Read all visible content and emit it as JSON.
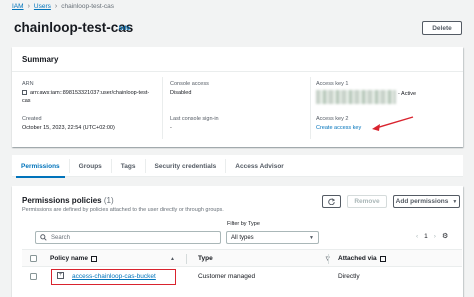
{
  "breadcrumb": {
    "root": "IAM",
    "users": "Users",
    "current": "chainloop-test-cas"
  },
  "header": {
    "title": "chainloop-test-cas",
    "info": "Info",
    "delete_label": "Delete"
  },
  "summary": {
    "title": "Summary",
    "arn_label": "ARN",
    "arn_value": "arn:aws:iam::898153321037:user/chainloop-test-cas",
    "created_label": "Created",
    "created_value": "October 15, 2023, 22:54 (UTC+02:00)",
    "console_access_label": "Console access",
    "console_access_value": "Disabled",
    "last_signin_label": "Last console sign-in",
    "last_signin_value": "-",
    "access_key1_label": "Access key 1",
    "access_key1_status": "- Active",
    "access_key2_label": "Access key 2",
    "create_access_key": "Create access key"
  },
  "tabs": [
    "Permissions",
    "Groups",
    "Tags",
    "Security credentials",
    "Access Advisor"
  ],
  "permissions": {
    "title": "Permissions policies",
    "count": "(1)",
    "description": "Permissions are defined by policies attached to the user directly or through groups.",
    "remove_label": "Remove",
    "add_label": "Add permissions",
    "filter_by_type_label": "Filter by Type",
    "search_placeholder": "Search",
    "type_select_value": "All types",
    "page_number": "1",
    "columns": {
      "policy_name": "Policy name",
      "type": "Type",
      "attached_via": "Attached via"
    },
    "rows": [
      {
        "policy_name": "access-chainloop-cas-bucket",
        "type": "Customer managed",
        "attached_via": "Directly"
      }
    ]
  },
  "colors": {
    "link": "#0073bb",
    "highlight": "#d9232e",
    "title": "#16191f"
  },
  "icons": [
    "chevron-right-icon",
    "copy-icon",
    "refresh-icon",
    "caret-down-icon",
    "search-icon",
    "external-link-icon",
    "chevron-left-icon",
    "gear-icon",
    "expand-icon",
    "sort-icon",
    "red-arrow-annotation"
  ]
}
